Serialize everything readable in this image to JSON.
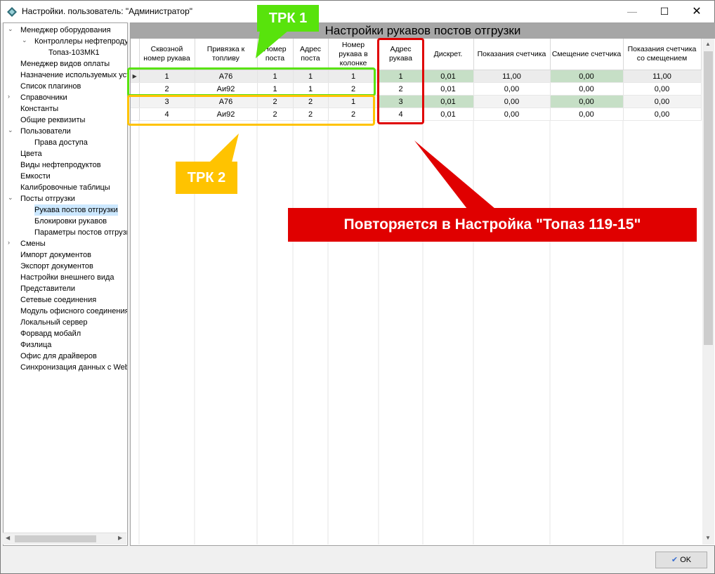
{
  "window": {
    "title": "Настройки. пользователь: \"Администратор\"",
    "minimize": "—",
    "maximize": "☐",
    "close": "✕"
  },
  "tree": [
    {
      "label": "Менеджер оборудования",
      "expander": "⌄"
    },
    {
      "label": "Контроллеры нефтепродуктов",
      "expander": "⌄"
    },
    {
      "label": "Топаз-103МК1",
      "expander": ""
    },
    {
      "label": "Менеджер видов оплаты",
      "expander": ""
    },
    {
      "label": "Назначение используемых устройств",
      "expander": ""
    },
    {
      "label": "Список плагинов",
      "expander": ""
    },
    {
      "label": "Справочники",
      "expander": "›"
    },
    {
      "label": "Константы",
      "expander": ""
    },
    {
      "label": "Общие реквизиты",
      "expander": ""
    },
    {
      "label": "Пользователи",
      "expander": "⌄"
    },
    {
      "label": "Права доступа",
      "expander": ""
    },
    {
      "label": "Цвета",
      "expander": ""
    },
    {
      "label": "Виды нефтепродуктов",
      "expander": ""
    },
    {
      "label": "Емкости",
      "expander": ""
    },
    {
      "label": "Калибровочные таблицы",
      "expander": ""
    },
    {
      "label": "Посты отгрузки",
      "expander": "⌄"
    },
    {
      "label": "Рукава постов отгрузки",
      "expander": ""
    },
    {
      "label": "Блокировки рукавов",
      "expander": ""
    },
    {
      "label": "Параметры постов отгрузки",
      "expander": ""
    },
    {
      "label": "Смены",
      "expander": "›"
    },
    {
      "label": "Импорт документов",
      "expander": ""
    },
    {
      "label": "Экспорт документов",
      "expander": ""
    },
    {
      "label": "Настройки внешнего вида",
      "expander": ""
    },
    {
      "label": "Представители",
      "expander": ""
    },
    {
      "label": "Сетевые соединения",
      "expander": ""
    },
    {
      "label": "Модуль офисного соединения",
      "expander": ""
    },
    {
      "label": "Локальный сервер",
      "expander": ""
    },
    {
      "label": "Форвард мобайл",
      "expander": ""
    },
    {
      "label": "Физлица",
      "expander": ""
    },
    {
      "label": "Офис для драйверов",
      "expander": ""
    },
    {
      "label": "Синхронизация данных с Web",
      "expander": ""
    }
  ],
  "panel": {
    "title": "Настройки рукавов постов отгрузки",
    "columns": [
      "Сквозной номер рукава",
      "Привязка к топливу",
      "Номер поста",
      "Адрес поста",
      "Номер рукава в колонке",
      "Адрес рукава",
      "Дискрет.",
      "Показания счетчика",
      "Смещение счетчика",
      "Показания счетчика со смещением"
    ],
    "rows": [
      [
        "1",
        "А76",
        "1",
        "1",
        "1",
        "1",
        "0,01",
        "11,00",
        "0,00",
        "11,00"
      ],
      [
        "2",
        "Аи92",
        "1",
        "1",
        "2",
        "2",
        "0,01",
        "0,00",
        "0,00",
        "0,00"
      ],
      [
        "3",
        "А76",
        "2",
        "2",
        "1",
        "3",
        "0,01",
        "0,00",
        "0,00",
        "0,00"
      ],
      [
        "4",
        "Аи92",
        "2",
        "2",
        "2",
        "4",
        "0,01",
        "0,00",
        "0,00",
        "0,00"
      ]
    ],
    "row_indicator": "▶"
  },
  "footer": {
    "ok_label": "OK"
  },
  "annotations": {
    "trk1": "ТРК 1",
    "trk2": "ТРК 2",
    "callout": "Повторяется в Настройка \"Топаз 119-15\"",
    "green": "#58e30c",
    "yellow": "#ffc300",
    "red": "#e00000"
  }
}
